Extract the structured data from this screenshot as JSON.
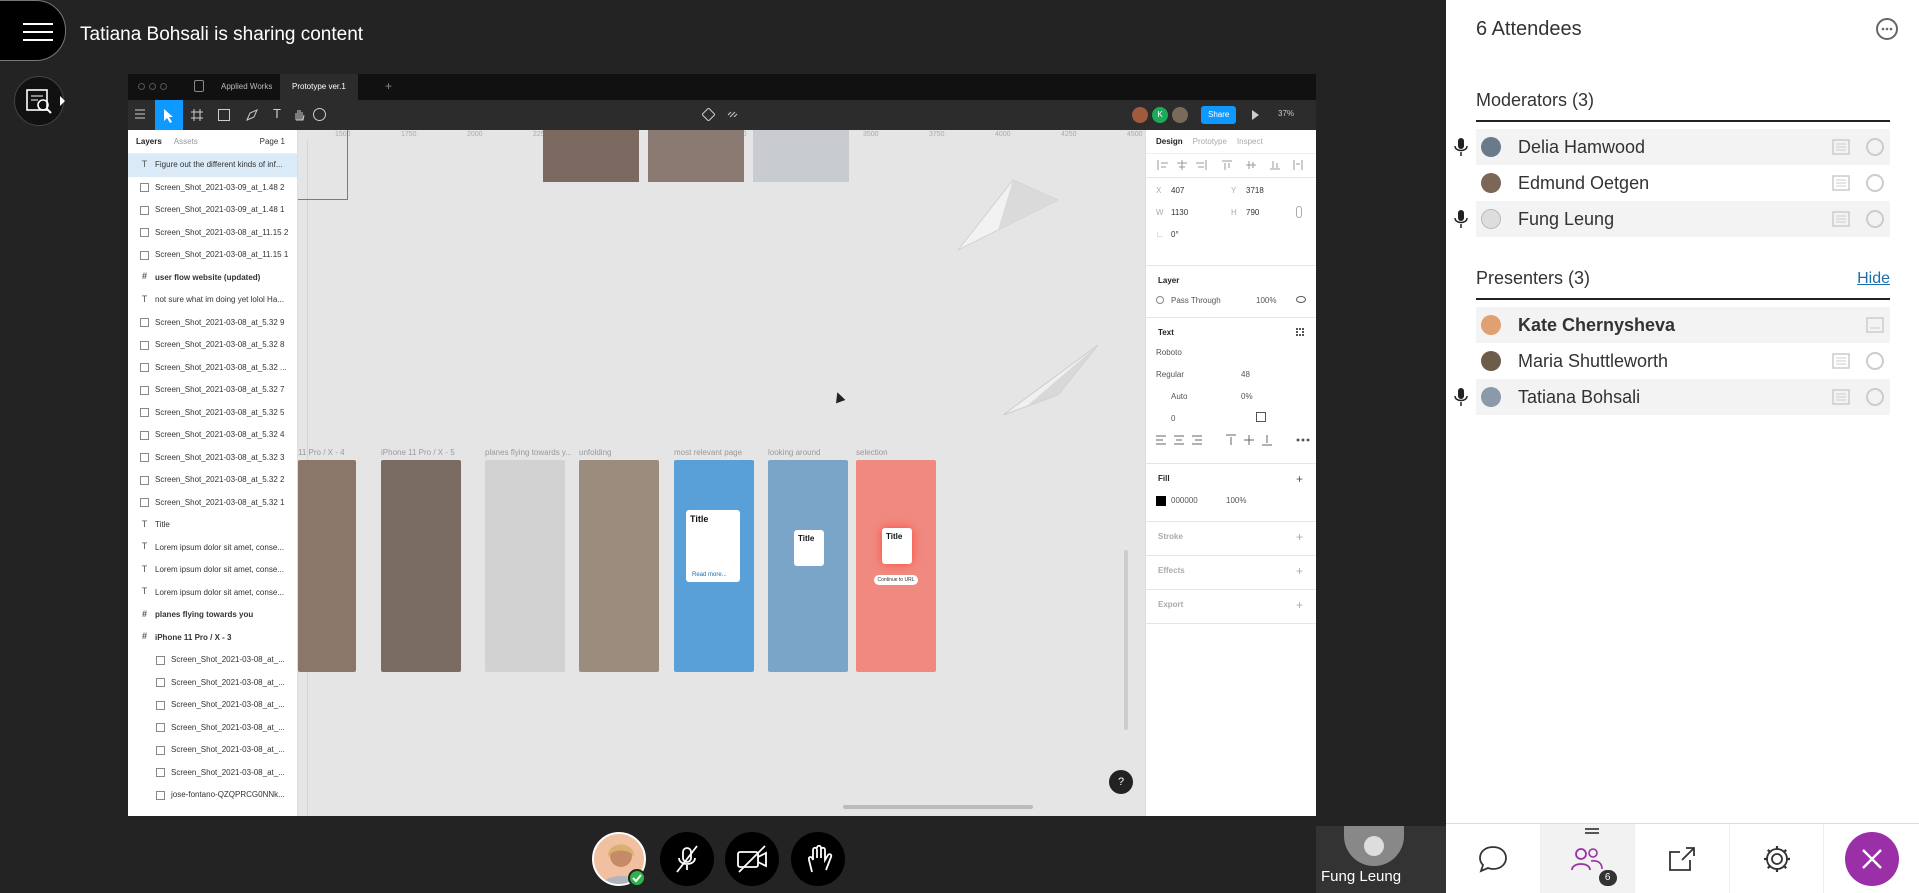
{
  "session": {
    "sharing_text": "Tatiana Bohsali is sharing content"
  },
  "figma": {
    "tabs": [
      "Applied Works",
      "Prototype ver.1"
    ],
    "share_label": "Share",
    "zoom": "37%",
    "panel_tabs": [
      "Layers",
      "Assets"
    ],
    "page_label": "Page 1",
    "ruler": [
      "1500",
      "1750",
      "2000",
      "2250",
      "2500",
      "2750",
      "3000",
      "3250",
      "3500",
      "3750",
      "4000",
      "4250",
      "4500"
    ],
    "layers": [
      {
        "icon": "T",
        "name": "Figure out the different kinds of inf..."
      },
      {
        "icon": "img",
        "name": "Screen_Shot_2021-03-09_at_1.48 2"
      },
      {
        "icon": "img",
        "name": "Screen_Shot_2021-03-09_at_1.48 1"
      },
      {
        "icon": "img",
        "name": "Screen_Shot_2021-03-08_at_11.15 2"
      },
      {
        "icon": "img",
        "name": "Screen_Shot_2021-03-08_at_11.15 1"
      },
      {
        "icon": "#",
        "name": "user flow website (updated)"
      },
      {
        "icon": "T",
        "name": "not sure what im doing yet lolol Ha..."
      },
      {
        "icon": "img",
        "name": "Screen_Shot_2021-03-08_at_5.32 9"
      },
      {
        "icon": "img",
        "name": "Screen_Shot_2021-03-08_at_5.32 8"
      },
      {
        "icon": "img",
        "name": "Screen_Shot_2021-03-08_at_5.32 ..."
      },
      {
        "icon": "img",
        "name": "Screen_Shot_2021-03-08_at_5.32 7"
      },
      {
        "icon": "img",
        "name": "Screen_Shot_2021-03-08_at_5.32 5"
      },
      {
        "icon": "img",
        "name": "Screen_Shot_2021-03-08_at_5.32 4"
      },
      {
        "icon": "img",
        "name": "Screen_Shot_2021-03-08_at_5.32 3"
      },
      {
        "icon": "img",
        "name": "Screen_Shot_2021-03-08_at_5.32 2"
      },
      {
        "icon": "img",
        "name": "Screen_Shot_2021-03-08_at_5.32 1"
      },
      {
        "icon": "T",
        "name": "Title"
      },
      {
        "icon": "T",
        "name": "Lorem ipsum dolor sit amet, conse..."
      },
      {
        "icon": "T",
        "name": "Lorem ipsum dolor sit amet, conse..."
      },
      {
        "icon": "T",
        "name": "Lorem ipsum dolor sit amet, conse..."
      },
      {
        "icon": "#",
        "name": "planes flying towards you"
      },
      {
        "icon": "#",
        "name": "iPhone 11 Pro / X - 3"
      },
      {
        "icon": "img",
        "name": "Screen_Shot_2021-03-08_at_..."
      },
      {
        "icon": "img",
        "name": "Screen_Shot_2021-03-08_at_..."
      },
      {
        "icon": "img",
        "name": "Screen_Shot_2021-03-08_at_..."
      },
      {
        "icon": "img",
        "name": "Screen_Shot_2021-03-08_at_..."
      },
      {
        "icon": "img",
        "name": "Screen_Shot_2021-03-08_at_..."
      },
      {
        "icon": "img",
        "name": "Screen_Shot_2021-03-08_at_..."
      },
      {
        "icon": "img",
        "name": "jose-fontano-QZQPRCG0NNk..."
      }
    ],
    "frames": [
      "11 Pro / X - 4",
      "iPhone 11 Pro / X - 5",
      "planes flying towards y...",
      "unfolding",
      "most relevant page",
      "looking around",
      "selection"
    ],
    "frame_title": "Title",
    "frame_link": "Read more...",
    "frame_button": "Continue to URL",
    "design": {
      "tabs": [
        "Design",
        "Prototype",
        "Inspect"
      ],
      "x": "407",
      "y": "3718",
      "w": "1130",
      "h": "790",
      "rot": "0°",
      "layer_h": "Layer",
      "blend": "Pass Through",
      "opacity": "100%",
      "text_h": "Text",
      "font": "Roboto",
      "weight": "Regular",
      "size": "48",
      "line": "Auto",
      "letter": "0%",
      "para": "0",
      "fill_h": "Fill",
      "fill_hex": "000000",
      "fill_op": "100%",
      "stroke_h": "Stroke",
      "effects_h": "Effects",
      "export_h": "Export"
    }
  },
  "attendees": {
    "title": "6 Attendees",
    "moderators": {
      "heading": "Moderators (3)",
      "people": [
        "Delia Hamwood",
        "Edmund Oetgen",
        "Fung Leung"
      ]
    },
    "presenters": {
      "heading": "Presenters (3)",
      "hide_label": "Hide",
      "people": [
        "Kate Chernysheva",
        "Maria Shuttleworth",
        "Tatiana Bohsali"
      ]
    },
    "count_badge": "6"
  },
  "video": {
    "self_name": "Fung Leung"
  },
  "colors": {
    "accent": "#9b2fa8",
    "link": "#1b6ea6",
    "figma_blue": "#0d99ff"
  }
}
